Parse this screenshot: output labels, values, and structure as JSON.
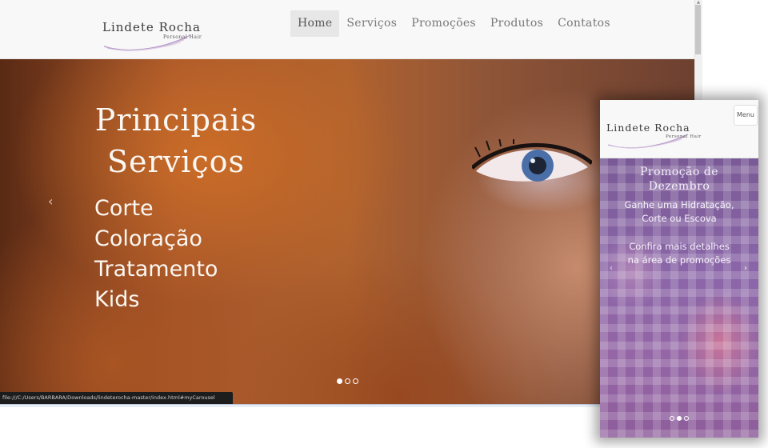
{
  "desktop": {
    "logo": {
      "name": "Lindete Rocha",
      "tagline": "Personal Hair"
    },
    "nav": [
      {
        "label": "Home"
      },
      {
        "label": "Serviços"
      },
      {
        "label": "Promoções"
      },
      {
        "label": "Produtos"
      },
      {
        "label": "Contatos"
      }
    ],
    "active_nav": "Home",
    "hero": {
      "title_line1": "Principais",
      "title_line2": "Serviços",
      "services": [
        "Corte",
        "Coloração",
        "Tratamento",
        "Kids"
      ],
      "prev_glyph": "‹",
      "slide_count": 3,
      "active_slide": 1
    },
    "status_url": "file:///C:/Users/BARBARA/Downloads/lindeterocha-master/index.html#myCarousel"
  },
  "mobile": {
    "logo": {
      "name": "Lindete Rocha",
      "tagline": "Personal Hair"
    },
    "menu_label": "Menu",
    "promo_title_line1": "Promoção de",
    "promo_title_line2": "Dezembro",
    "promo_text_line1": "Ganhe uma Hidratação,",
    "promo_text_line2": "Corte ou Escova",
    "details_line1": "Confira mais detalhes",
    "details_line2": "na área de promoções",
    "prev_glyph": "‹",
    "next_glyph": "›",
    "slide_count": 3,
    "active_slide": 2
  },
  "colors": {
    "navbar_bg": "#f8f8f8",
    "nav_text": "#777777",
    "nav_active_bg": "#e7e7e7",
    "hero_text": "#fbf7f2",
    "logo_swoosh": "#b79ac8"
  }
}
